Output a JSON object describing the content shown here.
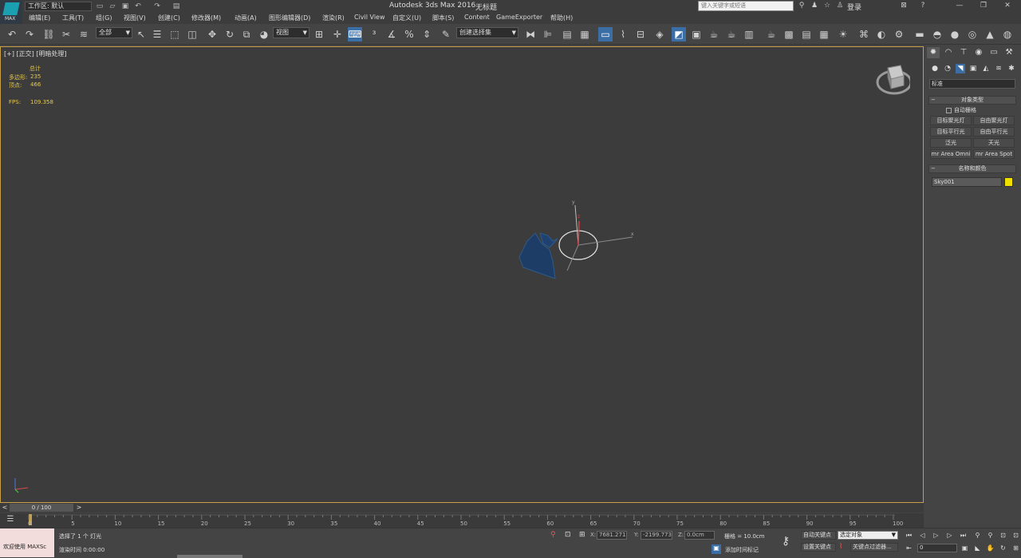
{
  "app": {
    "logo_label": "MAX",
    "workspace": "工作区: 默认",
    "title": "Autodesk 3ds Max 2016",
    "doc_title": "无标题",
    "search_placeholder": "键入关键字或短语",
    "login_label": "登录",
    "window_controls": {
      "help": "?",
      "minimize": "—",
      "restore": "❐",
      "close": "✕"
    }
  },
  "menu": [
    "编辑(E)",
    "工具(T)",
    "组(G)",
    "视图(V)",
    "创建(C)",
    "修改器(M)",
    "动画(A)",
    "图形编辑器(D)",
    "渲染(R)",
    "Civil View",
    "自定义(U)",
    "脚本(S)",
    "Content",
    "GameExporter",
    "帮助(H)"
  ],
  "toolbar": {
    "selection_filter": "全部",
    "reference_coord": "视图",
    "named_selection": "创建选择集"
  },
  "viewport": {
    "label": "[+] [正交] [明暗处理]",
    "stats": {
      "total_label": "总计",
      "polys_label": "多边形:",
      "polys_value": "235",
      "verts_label": "顶点:",
      "verts_value": "466",
      "fps_label": "FPS:",
      "fps_value": "109.358"
    },
    "axis_labels": {
      "y": "y",
      "z": "z",
      "x": "x"
    }
  },
  "command_panel": {
    "dropdown": "标准",
    "object_type_title": "对象类型",
    "autogrid_label": "自动栅格",
    "buttons": [
      "目标聚光灯",
      "自由聚光灯",
      "目标平行光",
      "自由平行光",
      "泛光",
      "天光",
      "mr Area Omni",
      "mr Area Spot"
    ],
    "name_color_title": "名称和颜色",
    "object_name": "Sky001",
    "object_color": "#f0e000"
  },
  "timeline": {
    "position": "0 / 100",
    "ticks": [
      "0",
      "5",
      "10",
      "15",
      "20",
      "25",
      "30",
      "35",
      "40",
      "45",
      "50",
      "55",
      "60",
      "65",
      "70",
      "75",
      "80",
      "85",
      "90",
      "95",
      "100"
    ]
  },
  "status": {
    "welcome": "欢迎使用 MAXSc",
    "selection_text": "选择了 1 个 灯光",
    "render_time": "渲染时间 0:00:00",
    "x_label": "X:",
    "x_value": "7681.271",
    "y_label": "Y:",
    "y_value": "-2199.773",
    "z_label": "Z:",
    "z_value": "0.0cm",
    "grid": "栅格 = 10.0cm",
    "add_time_tag": "添加时间标记",
    "auto_key": "自动关键点",
    "set_key": "设置关键点",
    "selected_object": "选定对象",
    "key_filters": "关键点过滤器...",
    "frame": "0"
  }
}
